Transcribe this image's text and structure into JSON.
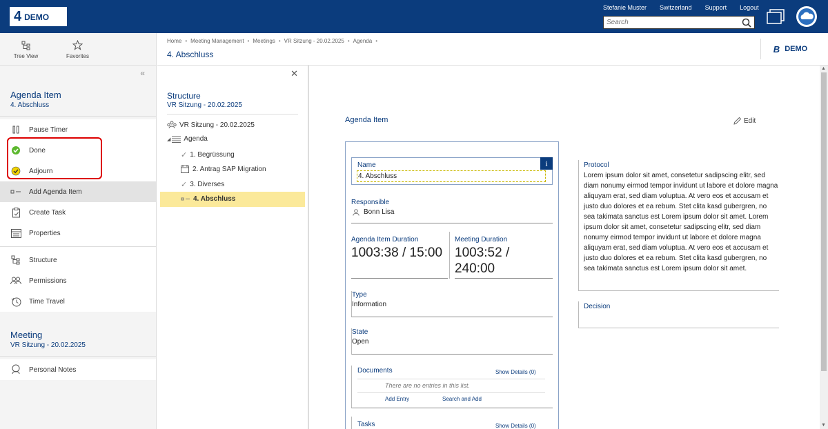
{
  "header": {
    "logo_mark": "4",
    "logo_text": "DEMO",
    "links": [
      "Stefanie Muster",
      "Switzerland",
      "Support",
      "Logout"
    ],
    "search_placeholder": "Search"
  },
  "leftnav": {
    "tools": [
      {
        "label": "Tree View"
      },
      {
        "label": "Favorites"
      }
    ],
    "agenda_section": {
      "title": "Agenda Item",
      "subtitle": "4. Abschluss"
    },
    "items": [
      {
        "label": "Pause Timer"
      },
      {
        "label": "Done"
      },
      {
        "label": "Adjourn"
      },
      {
        "label": "Add Agenda Item"
      },
      {
        "label": "Create Task"
      },
      {
        "label": "Properties"
      },
      {
        "label": "Structure"
      },
      {
        "label": "Permissions"
      },
      {
        "label": "Time Travel"
      }
    ],
    "meeting_section": {
      "title": "Meeting",
      "subtitle": "VR Sitzung - 20.02.2025"
    },
    "meeting_items": [
      {
        "label": "Personal Notes"
      }
    ]
  },
  "breadcrumb": {
    "items": [
      "Home",
      "Meeting Management",
      "Meetings",
      "VR Sitzung - 20.02.2025",
      "Agenda"
    ],
    "title": "4. Abschluss"
  },
  "right_logo": {
    "mark": "B",
    "text": "DEMO"
  },
  "structure": {
    "title": "Structure",
    "subtitle": "VR Sitzung - 20.02.2025",
    "root": "VR Sitzung - 20.02.2025",
    "agenda": "Agenda",
    "children": [
      "1. Begrüssung",
      "2. Antrag SAP Migration",
      "3. Diverses",
      "4. Abschluss"
    ]
  },
  "detail": {
    "heading": "Agenda Item",
    "edit_label": "Edit",
    "info_glyph": "i",
    "name_label": "Name",
    "name_value": "4. Abschluss",
    "responsible_label": "Responsible",
    "responsible_value": "Bonn Lisa",
    "duration_label": "Agenda Item Duration",
    "duration_value": "1003:38 / 15:00",
    "meeting_duration_label": "Meeting Duration",
    "meeting_duration_value": "1003:52 / 240:00",
    "type_label": "Type",
    "type_value": "Information",
    "state_label": "State",
    "state_value": "Open",
    "documents_label": "Documents",
    "documents_show": "Show Details (0)",
    "documents_empty": "There are no entries in this list.",
    "add_entry": "Add Entry",
    "search_add": "Search and Add",
    "tasks_label": "Tasks",
    "tasks_show": "Show Details (0)",
    "protocol_label": "Protocol",
    "protocol_text": "Lorem ipsum dolor sit amet, consetetur sadipscing elitr, sed diam nonumy eirmod tempor invidunt ut labore et dolore magna aliquyam erat, sed diam voluptua. At vero eos et accusam et justo duo dolores et ea rebum. Stet clita kasd gubergren, no sea takimata sanctus est Lorem ipsum dolor sit amet. Lorem ipsum dolor sit amet, consetetur sadipscing elitr, sed diam nonumy eirmod tempor invidunt ut labore et dolore magna aliquyam erat, sed diam voluptua. At vero eos et accusam et justo duo dolores et ea rebum. Stet clita kasd gubergren, no sea takimata sanctus est Lorem ipsum dolor sit amet.",
    "decision_label": "Decision"
  },
  "colors": {
    "brand": "#0b3c7d",
    "done": "#5cb82e",
    "adjourn": "#f2d300",
    "selected": "#fbe99a",
    "highlight": "#dd0000"
  }
}
